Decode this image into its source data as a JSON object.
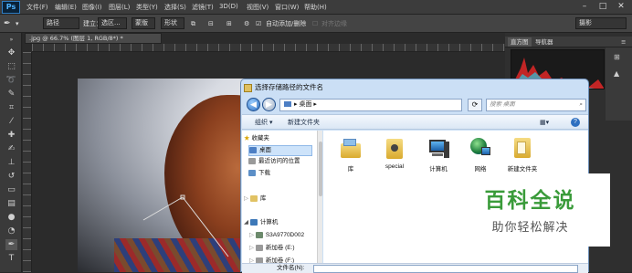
{
  "app": {
    "logo": "Ps"
  },
  "menu": [
    "文件(F)",
    "编辑(E)",
    "图像(I)",
    "图层(L)",
    "类型(Y)",
    "选择(S)",
    "滤镜(T)",
    "3D(D)",
    "视图(V)",
    "窗口(W)",
    "帮助(H)"
  ],
  "options": {
    "feather_mode": "路径",
    "create_label": "建立：",
    "selection_btn": "选区...",
    "mask_btn": "蒙版",
    "shape_btn": "形状",
    "auto_add_delete": "自动添加/删除",
    "align_edges": "对齐边缘",
    "workspace": "摄影"
  },
  "document": {
    "tab_title": ".jpg @ 66.7% (图层 1, RGB/8*) *"
  },
  "panels": {
    "histogram_tab": "直方图",
    "navigator_tab": "导航器"
  },
  "dialog": {
    "title": "选择存储路径的文件名",
    "address": "桌面",
    "search_placeholder": "搜索 桌面",
    "organize": "组织 ▾",
    "new_folder": "新建文件夹",
    "nav": {
      "favorites": "收藏夹",
      "desktop": "桌面",
      "recent": "最近访问的位置",
      "downloads": "下载",
      "libraries": "库",
      "computer": "计算机",
      "drive1": "S3A9770D002",
      "drive2": "新加卷 (E:)",
      "drive3": "新加卷 (F:)"
    },
    "files": [
      "库",
      "special",
      "计算机",
      "网络",
      "新建文件夹"
    ],
    "filename_label": "文件名(N):"
  },
  "watermark": {
    "title": "百科全说",
    "subtitle": "助你轻松解决"
  },
  "colors": {
    "ps_blue": "#4fb3ff",
    "dialog_bg": "#cbdff5",
    "watermark_green": "#3a9b3a"
  }
}
